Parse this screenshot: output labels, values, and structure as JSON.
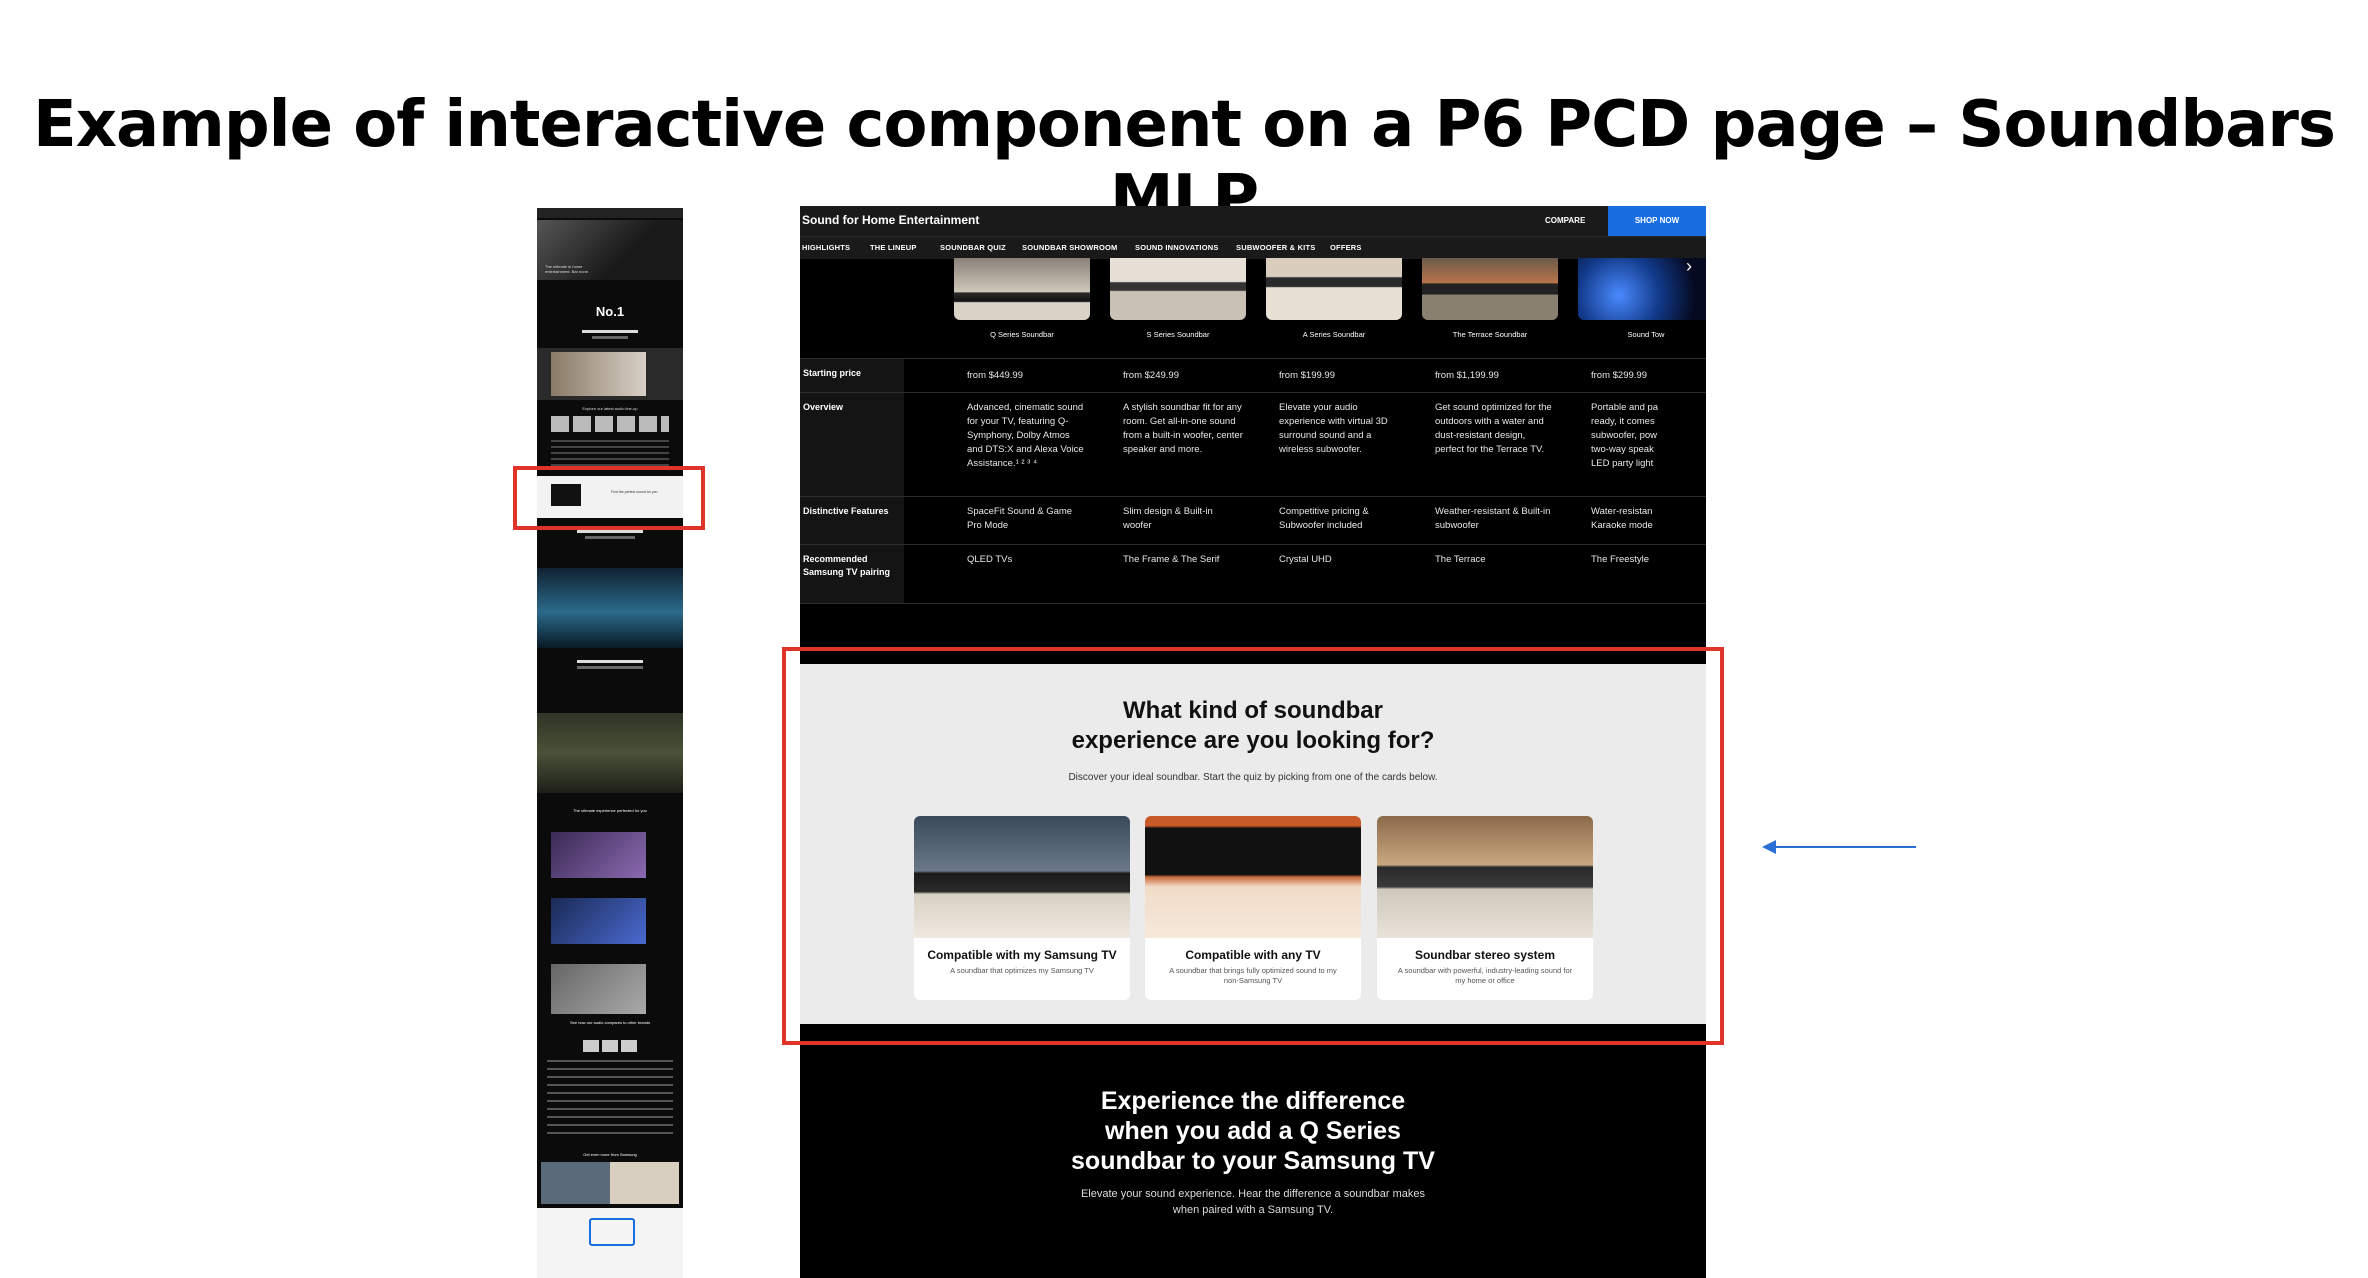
{
  "slide": {
    "title": "Example of interactive component on a P6 PCD page – Soundbars MLP"
  },
  "thumbnail": {
    "hero_text": "The ultimate in home entertainment. Bar none.",
    "badge": "No.1",
    "section1": "Explore our latest audio line-up",
    "highlight_label": "Find the perfect sound for you",
    "experience": "The ultimate experience perfected for you",
    "compare": "See how our audio compares to other brands",
    "more": "Get even more from Samsung"
  },
  "header": {
    "brand": "Sound for Home Entertainment",
    "compare": "COMPARE",
    "shop_now": "SHOP NOW"
  },
  "nav": [
    "HIGHLIGHTS",
    "THE LINEUP",
    "SOUNDBAR QUIZ",
    "SOUNDBAR SHOWROOM",
    "SOUND INNOVATIONS",
    "SUBWOOFER & KITS",
    "OFFERS"
  ],
  "products": [
    {
      "name": "Q Series Soundbar"
    },
    {
      "name": "S Series Soundbar"
    },
    {
      "name": "A Series Soundbar"
    },
    {
      "name": "The Terrace Soundbar"
    },
    {
      "name": "Sound Tow"
    }
  ],
  "table": {
    "rows": [
      {
        "label": "Starting price",
        "cells": [
          "from $449.99",
          "from $249.99",
          "from $199.99",
          "from $1,199.99",
          "from $299.99"
        ]
      },
      {
        "label": "Overview",
        "cells": [
          "Advanced, cinematic sound for your TV, featuring Q-Symphony, Dolby Atmos and DTS:X and Alexa Voice Assistance.¹ ² ³ ⁴",
          "A stylish soundbar fit for any room. Get all-in-one sound from a built-in woofer, center speaker and more.",
          "Elevate your audio experience with virtual 3D surround sound and a wireless subwoofer.",
          "Get sound optimized for the outdoors with a water and dust-resistant design, perfect for the Terrace TV.",
          "Portable and pa ready, it comes subwoofer, pow two-way speak LED party light"
        ]
      },
      {
        "label": "Distinctive Features",
        "cells": [
          "SpaceFit Sound & Game Pro Mode",
          "Slim design & Built-in woofer",
          "Competitive pricing & Subwoofer included",
          "Weather-resistant & Built-in subwoofer",
          "Water-resistan Karaoke mode"
        ]
      },
      {
        "label": "Recommended Samsung TV pairing",
        "cells": [
          "QLED TVs",
          "The Frame & The Serif",
          "Crystal UHD",
          "The Terrace",
          "The Freestyle"
        ]
      }
    ]
  },
  "quiz": {
    "heading_line1": "What kind of soundbar",
    "heading_line2": "experience are you looking for?",
    "subtitle": "Discover your ideal soundbar. Start the quiz by picking from one of the cards below.",
    "cards": [
      {
        "title": "Compatible with my Samsung TV",
        "desc": "A soundbar that optimizes my Samsung TV"
      },
      {
        "title": "Compatible with any TV",
        "desc": "A soundbar that brings fully optimized sound to my non-Samsung TV"
      },
      {
        "title": "Soundbar stereo system",
        "desc": "A soundbar with powerful, industry-leading sound for my home or office"
      }
    ]
  },
  "experience": {
    "line1": "Experience the difference",
    "line2": "when you add a Q Series",
    "line3": "soundbar to your Samsung TV",
    "sub1": "Elevate your sound experience. Hear the difference a soundbar makes",
    "sub2": "when paired with a Samsung TV."
  },
  "colors": {
    "highlight": "#e0332a",
    "arrow": "#2a6fd6",
    "shop_button": "#1a6de0"
  }
}
